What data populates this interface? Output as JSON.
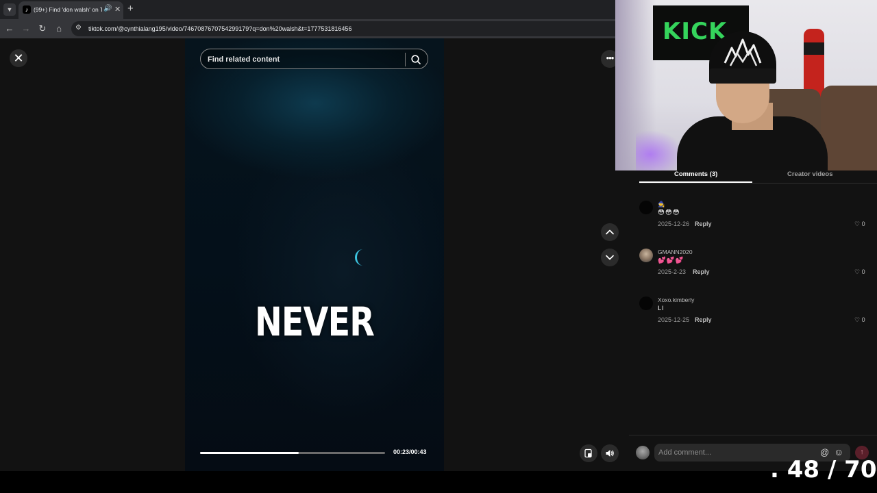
{
  "browser": {
    "tab_title": "(99+) Find 'don walsh' on Ti",
    "url": "tiktok.com/@cynthialang195/video/7467087670754299179?q=don%20walsh&t=1777531816456"
  },
  "video": {
    "search_placeholder": "Find related content",
    "caption": "NEVER",
    "time": "00:23/00:43",
    "progress": 0.535
  },
  "tabs": {
    "comments": "Comments (3)",
    "creator": "Creator videos"
  },
  "comments": [
    {
      "user": "🧙",
      "text": "😳😳😳",
      "date": "2025-12-26",
      "reply": "Reply",
      "likes": "0"
    },
    {
      "user": "GMANN2020",
      "text": "💕💕💕",
      "date": "2025-2-23",
      "reply": "Reply",
      "likes": "0"
    },
    {
      "user": "Xoxo.kimberly",
      "text": "Ll",
      "date": "2025-12-25",
      "reply": "Reply",
      "likes": "0"
    }
  ],
  "comment_bar": {
    "placeholder": "Add comment..."
  },
  "overlay": {
    "counter": ". 48 / 70",
    "banner_text": "KICK"
  },
  "colors": {
    "accent": "#fe2c55",
    "kick_green": "#35d45c"
  },
  "icons": {
    "close": "close-icon",
    "search": "search-icon",
    "more": "more-icon",
    "up": "chevron-up-icon",
    "down": "chevron-down-icon",
    "pip": "picture-in-picture-icon",
    "volume": "volume-icon",
    "like": "heart-icon",
    "mention": "at-icon",
    "emoji": "emoji-icon",
    "send": "send-icon"
  }
}
